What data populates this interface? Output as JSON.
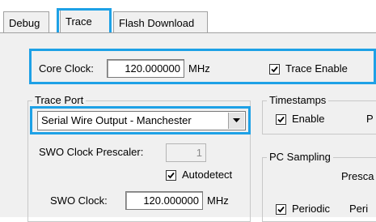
{
  "tabs": [
    {
      "label": "Debug"
    },
    {
      "label": "Trace"
    },
    {
      "label": "Flash Download"
    }
  ],
  "core_clock": {
    "label": "Core Clock:",
    "value": "120.000000",
    "unit": "MHz"
  },
  "trace_enable": {
    "label": "Trace Enable",
    "checked": true
  },
  "trace_port": {
    "title": "Trace Port",
    "selected": "Serial Wire Output - Manchester",
    "swo_prescaler_label": "SWO Clock Prescaler:",
    "swo_prescaler_value": "1",
    "autodetect_label": "Autodetect",
    "swo_clock_label": "SWO Clock:",
    "swo_clock_value": "120.000000",
    "swo_clock_unit": "MHz"
  },
  "timestamps": {
    "title": "Timestamps",
    "enable_label": "Enable",
    "partial": "P"
  },
  "pc_sampling": {
    "title": "PC Sampling",
    "prescaler_partial": "Presca",
    "periodic_label": "Periodic",
    "period_partial": "Peri"
  },
  "colors": {
    "highlight": "#1ea1e6",
    "panel": "#f0f0f0"
  }
}
